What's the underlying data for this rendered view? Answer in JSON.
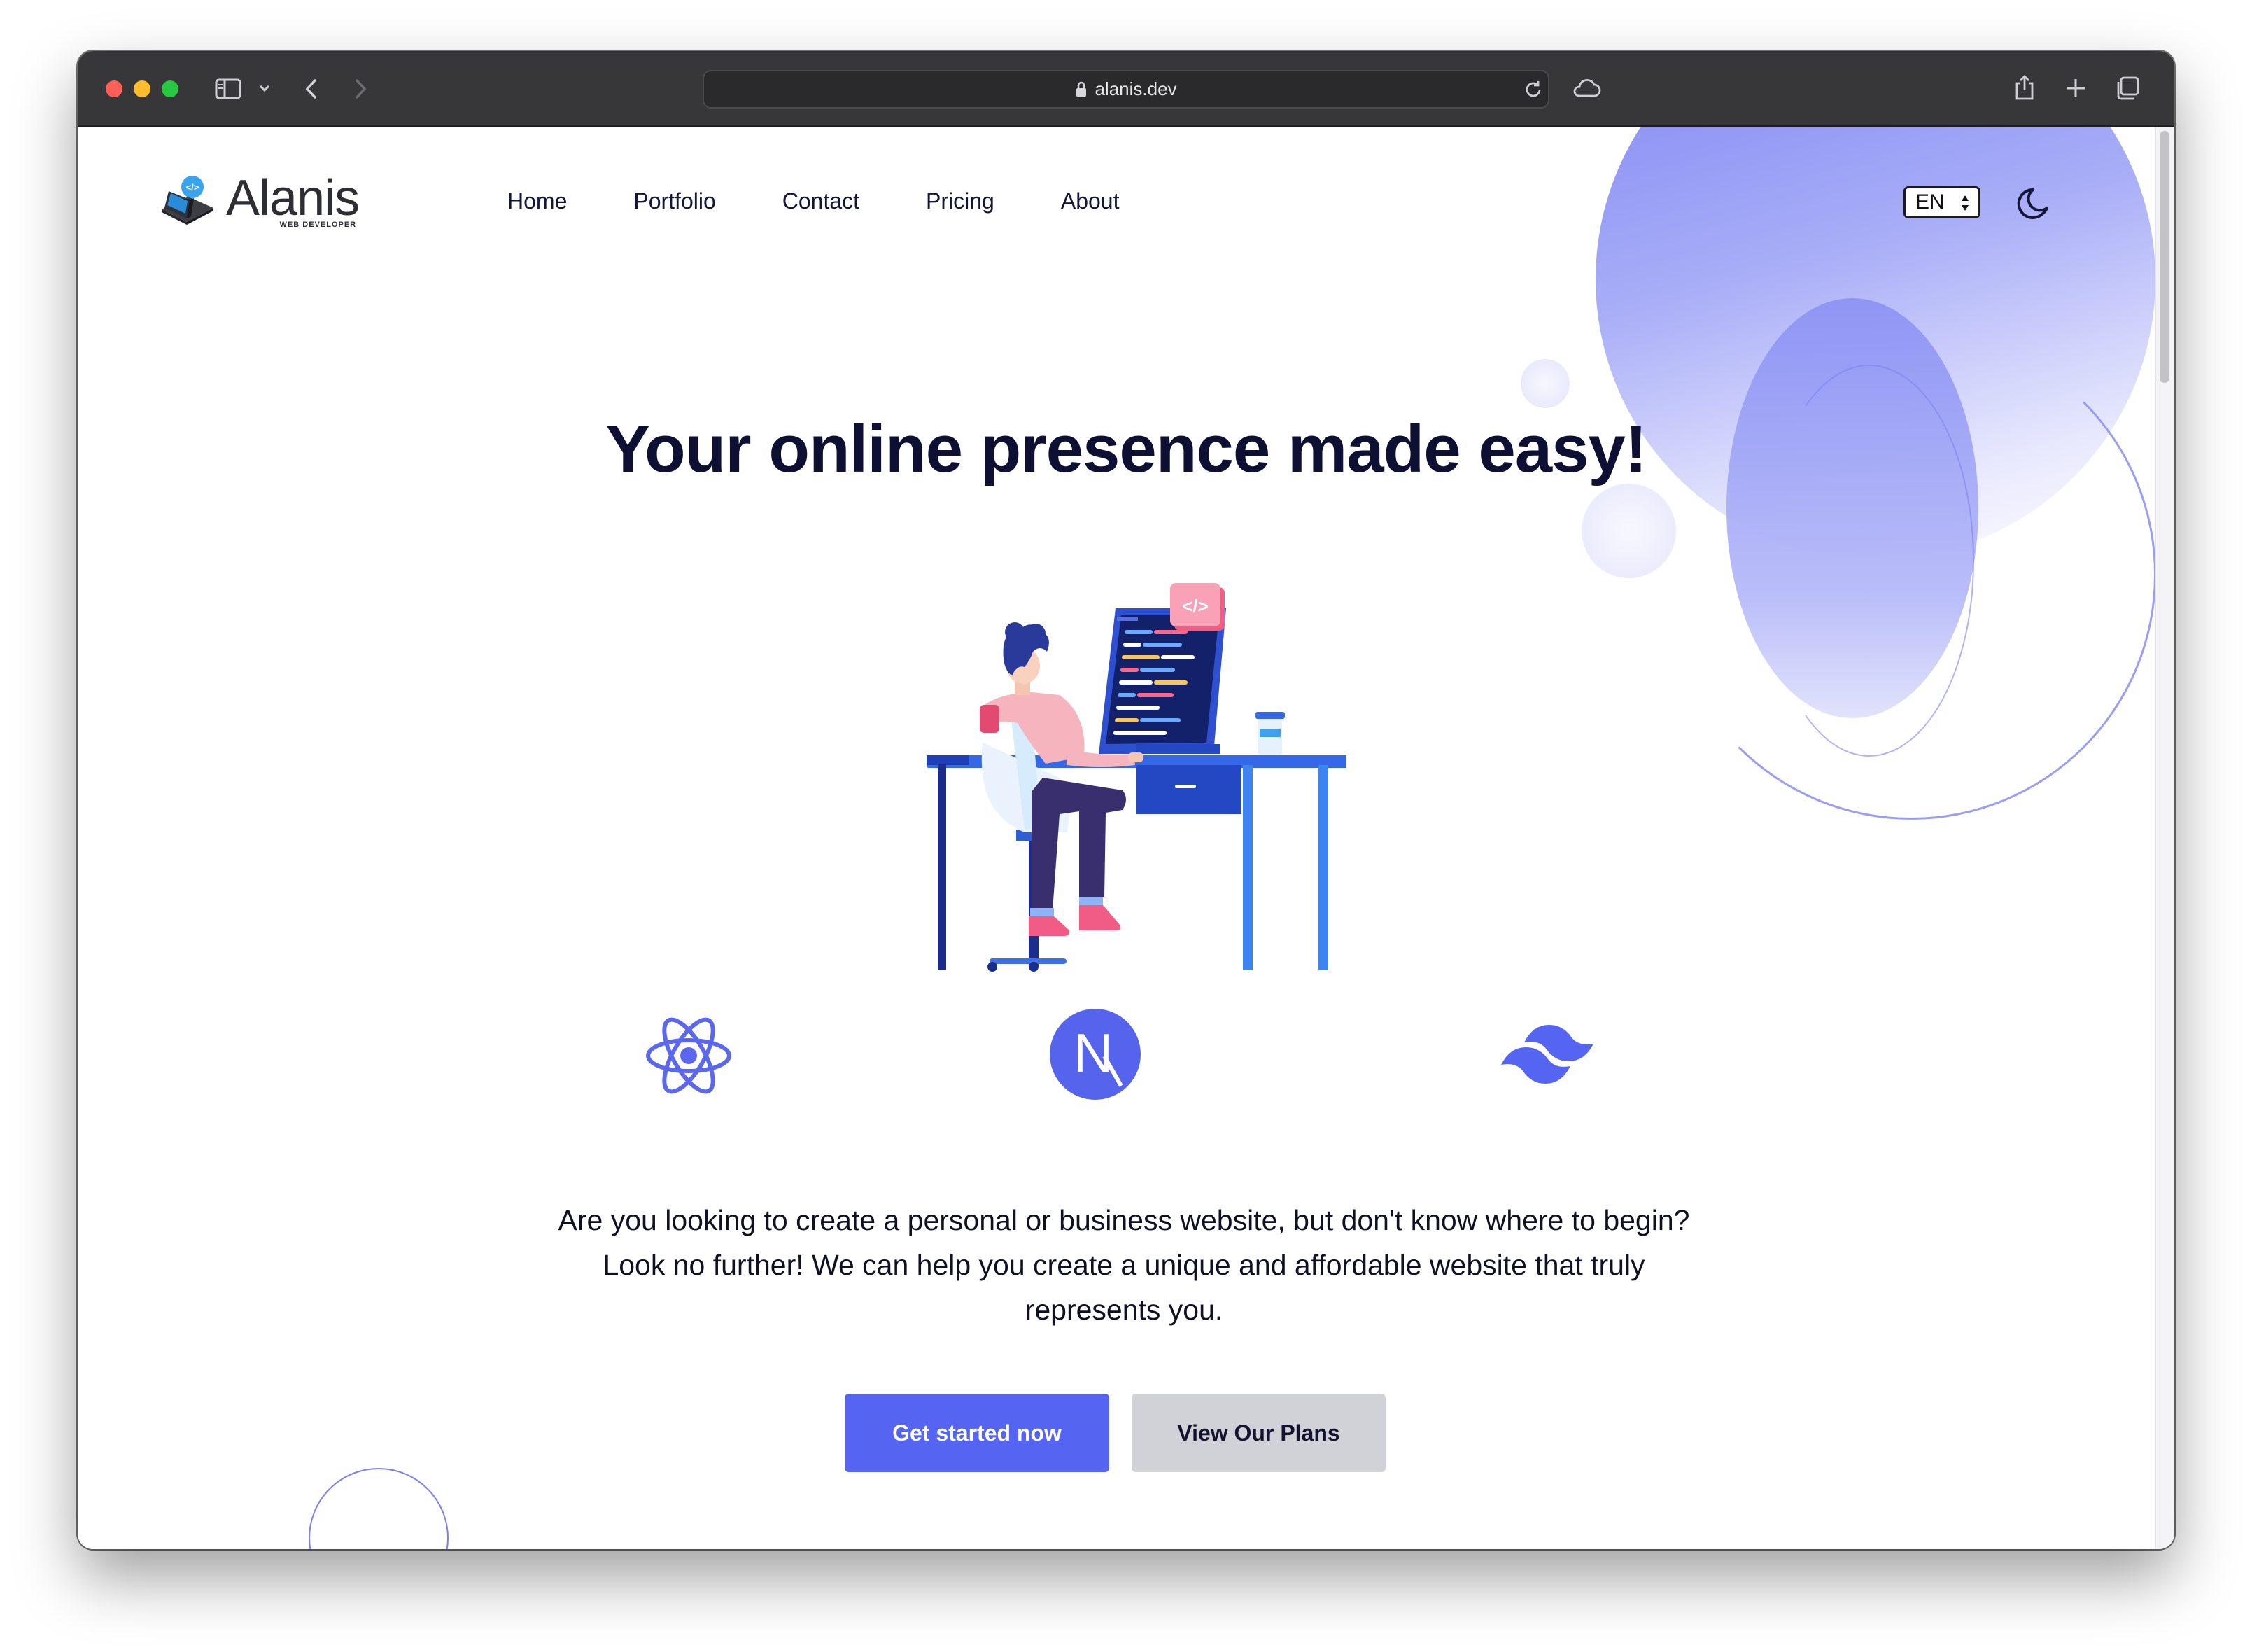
{
  "browser": {
    "url": "alanis.dev"
  },
  "header": {
    "logo_word": "Alanis",
    "logo_sub": "WEB DEVELOPER",
    "nav": [
      "Home",
      "Portfolio",
      "Contact",
      "Pricing",
      "About"
    ],
    "language": "EN"
  },
  "hero": {
    "title": "Your online presence made easy!",
    "description": "Are you looking to create a personal or business website, but don't know where to begin? Look no further! We can help you create a unique and affordable website that truly represents you.",
    "primary_button": "Get started now",
    "secondary_button": "View Our Plans",
    "code_badge": "</>",
    "next_letter": "N"
  },
  "colors": {
    "accent": "#5565f2",
    "secondary_button": "#d1d1d8",
    "title": "#0d0f33",
    "deco": "#8d93f4"
  },
  "icons": [
    "sidebar-toggle-icon",
    "chevron-down-icon",
    "back-icon",
    "forward-icon",
    "lock-icon",
    "reload-icon",
    "icloud-icon",
    "share-icon",
    "new-tab-icon",
    "tabs-overview-icon",
    "moon-icon",
    "react-icon",
    "nextjs-icon",
    "tailwind-icon"
  ]
}
